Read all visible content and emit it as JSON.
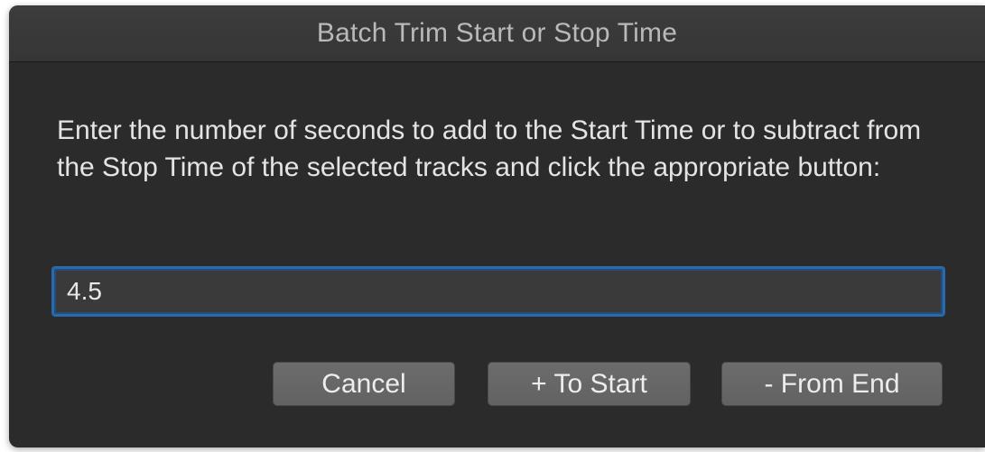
{
  "window": {
    "title": "Batch Trim Start or Stop Time"
  },
  "dialog": {
    "message": "Enter the number of seconds to add to the Start Time or to subtract from the Stop Time of the selected tracks and click the appropriate button:",
    "seconds_value": "4.5"
  },
  "buttons": {
    "cancel_label": "Cancel",
    "to_start_label": "+ To Start",
    "from_end_label": "- From End"
  },
  "colors": {
    "window_background": "#2b2b2b",
    "titlebar_background": "#3a3a3a",
    "focus_ring": "#2b6aa8",
    "button_background": "#666666"
  }
}
